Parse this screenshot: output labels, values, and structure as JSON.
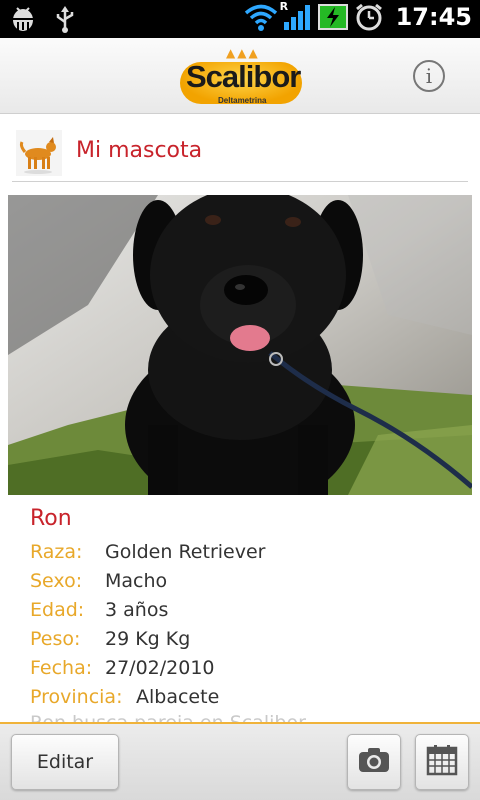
{
  "status_bar": {
    "time": "17:45",
    "icons": [
      "android-debug-icon",
      "usb-icon",
      "wifi-icon",
      "signal-icon",
      "battery-charging-icon",
      "alarm-icon"
    ],
    "roaming_label": "R"
  },
  "header": {
    "logo_text": "Scalibor",
    "logo_subtitle": "Deltametrina",
    "info_icon": "info-icon",
    "info_glyph": "i"
  },
  "section": {
    "icon": "dog-icon",
    "title": "Mi mascota"
  },
  "pet": {
    "name": "Ron",
    "details": [
      {
        "label": "Raza:",
        "value": "Golden Retriever"
      },
      {
        "label": "Sexo:",
        "value": "Macho"
      },
      {
        "label": "Edad:",
        "value": "3 años"
      },
      {
        "label": "Peso:",
        "value": "29 Kg Kg"
      },
      {
        "label": "Fecha:",
        "value": "27/02/2010"
      },
      {
        "label": "Provincia:",
        "value": "Albacete"
      }
    ],
    "faded_text": "Ron busca pareja en Scalibor"
  },
  "bottom_bar": {
    "edit_label": "Editar",
    "camera_icon": "camera-icon",
    "calendar_icon": "calendar-icon"
  },
  "colors": {
    "accent_red": "#c8232b",
    "label_gold": "#e8a82a",
    "divider_gold": "#f0b33a"
  }
}
